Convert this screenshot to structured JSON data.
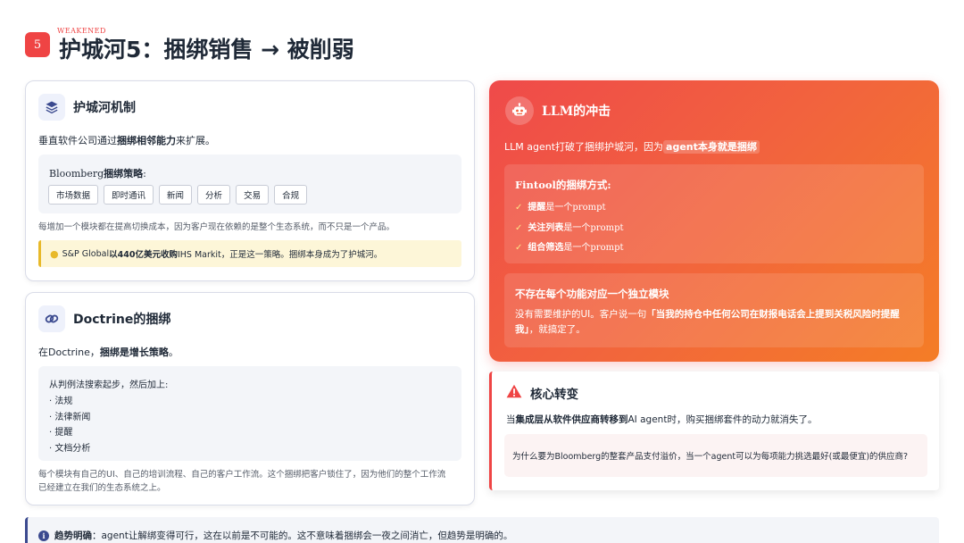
{
  "header": {
    "slide_number": "5",
    "tag": "WEAKENED",
    "title": "护城河5：捆绑销售 → 被削弱"
  },
  "moat_card": {
    "title": "护城河机制",
    "intro_pre": "垂直软件公司通过",
    "intro_bold": "捆绑相邻能力",
    "intro_post": "来扩展。",
    "strategy_prefix": "Bloomberg",
    "strategy_bold": "捆绑策略",
    "strategy_colon": ":",
    "chips": [
      "市场数据",
      "即时通讯",
      "新闻",
      "分析",
      "交易",
      "合规"
    ],
    "explanation": "每增加一个模块都在提高切换成本，因为客户现在依赖的是整个生态系统，而不只是一个产品。",
    "note_pre": "S&P Global",
    "note_bold": "以440亿美元收购",
    "note_post": "IHS Markit，正是这一策略。捆绑本身成为了护城河。"
  },
  "doctrine_card": {
    "title": "Doctrine的捆绑",
    "intro_pre": "在Doctrine，",
    "intro_bold": "捆绑是增长策略",
    "intro_post": "。",
    "list_title": "从判例法搜索起步，然后加上:",
    "items": [
      "· 法规",
      "· 法律新闻",
      "· 提醒",
      "· 文档分析"
    ],
    "footer_line1": "每个模块有自己的UI、自己的培训流程、自己的客户工作流。这个捆绑把客户锁住了，因为他们的整个工作流",
    "footer_line2": "已经建立在我们的生态系统之上。"
  },
  "llm_card": {
    "title": "LLM的冲击",
    "subtitle_pre": "LLM agent打破了捆绑护城河，因为",
    "subtitle_hl": "agent本身就是捆绑",
    "fintool_title": "Fintool的捆绑方式:",
    "fintool_items": [
      {
        "bold": "提醒",
        "rest": "是一个prompt"
      },
      {
        "bold": "关注列表",
        "rest": "是一个prompt"
      },
      {
        "bold": "组合筛选",
        "rest": "是一个prompt"
      }
    ],
    "no_module_title": "不存在每个功能对应一个独立模块",
    "no_module_pre": "没有需要维护的UI。客户说一句",
    "no_module_bold": "「当我的持仓中任何公司在财报电话会上提到关税风险时提醒我」",
    "no_module_post": "，就搞定了。"
  },
  "shift_card": {
    "title": "核心转变",
    "text_pre": "当",
    "text_bold": "集成层从软件供应商转移到",
    "text_post": "AI agent时，购买捆绑套件的动力就消失了。",
    "quote": "为什么要为Bloomberg的整套产品支付溢价，当一个agent可以为每项能力挑选最好(或最便宜)的供应商?"
  },
  "trend": {
    "label": "趋势明确",
    "colon": "：",
    "text": "agent让解绑变得可行，这在以前是不可能的。这不意味着捆绑会一夜之间消亡，但趋势是明确的。"
  }
}
